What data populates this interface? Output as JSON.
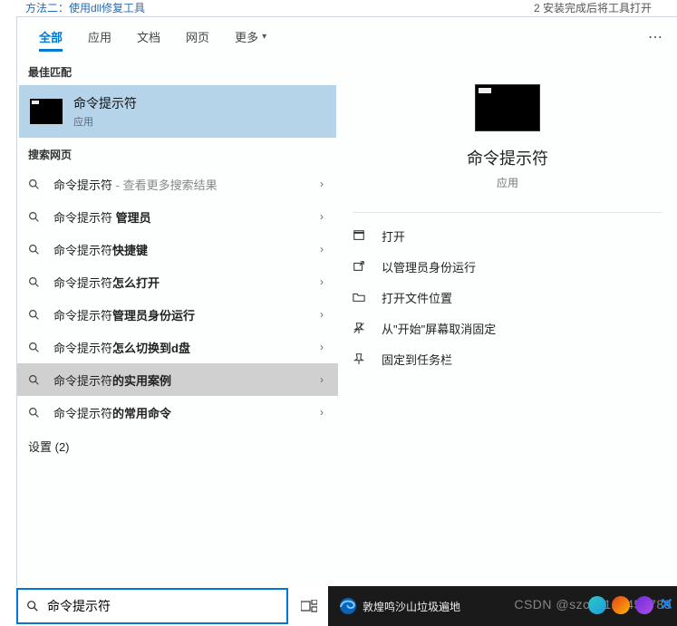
{
  "top_strip": {
    "left": "方法二：使用dll修复工具",
    "right": "2 安装完成后将工具打开"
  },
  "tabs": {
    "items": [
      {
        "label": "全部",
        "active": true
      },
      {
        "label": "应用"
      },
      {
        "label": "文档"
      },
      {
        "label": "网页"
      },
      {
        "label": "更多",
        "caret": true
      }
    ],
    "more_icon": "⋯"
  },
  "sections": {
    "best_label": "最佳匹配",
    "best_match": {
      "title": "命令提示符",
      "sub": "应用"
    },
    "web_label": "搜索网页",
    "web_items": [
      {
        "prefix": "命令提示符",
        "suffix": " - 查看更多搜索结果",
        "suffix_muted": true
      },
      {
        "prefix": "命令提示符 ",
        "bold": "管理员"
      },
      {
        "prefix": "命令提示符",
        "bold": "快捷键"
      },
      {
        "prefix": "命令提示符",
        "bold": "怎么打开"
      },
      {
        "prefix": "命令提示符",
        "bold": "管理员身份运行"
      },
      {
        "prefix": "命令提示符",
        "bold": "怎么切换到d盘"
      },
      {
        "prefix": "命令提示符",
        "bold": "的实用案例",
        "hovered": true
      },
      {
        "prefix": "命令提示符",
        "bold": "的常用命令"
      }
    ],
    "settings_label": "设置 (2)"
  },
  "preview": {
    "title": "命令提示符",
    "sub": "应用",
    "actions": [
      {
        "icon": "open",
        "label": "打开"
      },
      {
        "icon": "admin",
        "label": "以管理员身份运行"
      },
      {
        "icon": "folder",
        "label": "打开文件位置"
      },
      {
        "icon": "unpin",
        "label": "从\"开始\"屏幕取消固定"
      },
      {
        "icon": "pin",
        "label": "固定到任务栏"
      }
    ]
  },
  "taskbar": {
    "search_value": "命令提示符",
    "news": "敦煌鸣沙山垃圾遍地",
    "watermark": "CSDN @szcsd123456789"
  }
}
